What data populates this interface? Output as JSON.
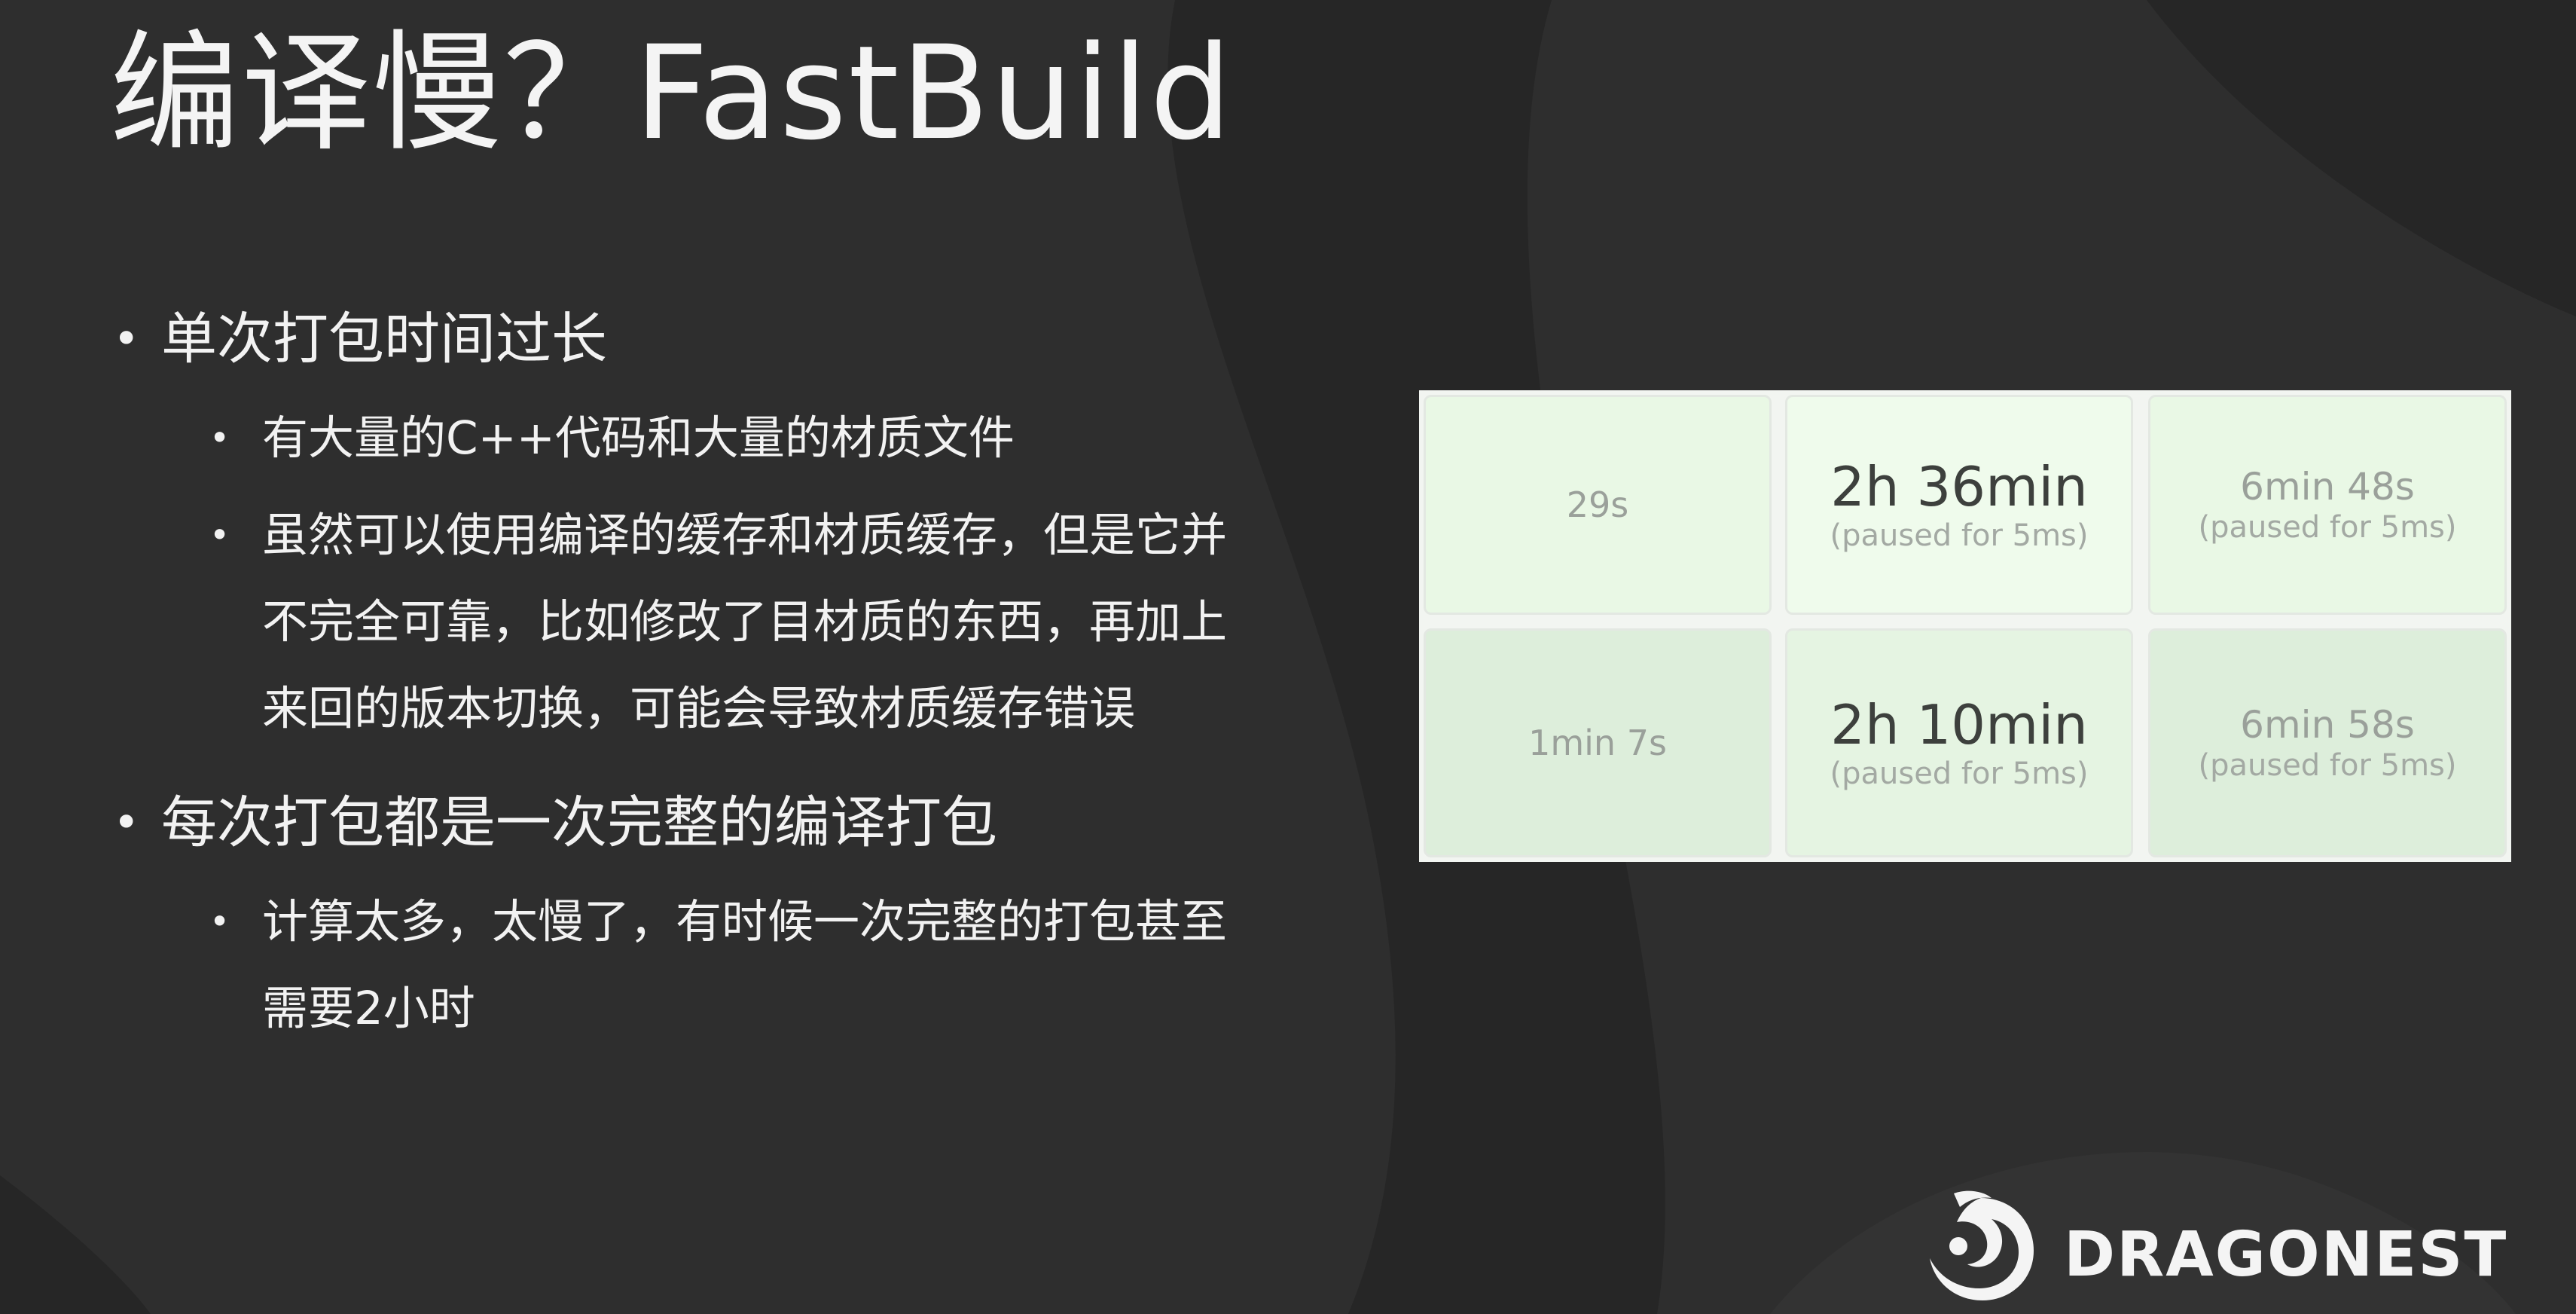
{
  "slide": {
    "title": "编译慢？FastBuild",
    "bullets": [
      {
        "text": "单次打包时间过长",
        "sub": [
          "有大量的C++代码和大量的材质文件",
          "虽然可以使用编译的缓存和材质缓存，但是它并不完全可靠，比如修改了目材质的东西，再加上来回的版本切换，可能会导致材质缓存错误"
        ]
      },
      {
        "text": "每次打包都是一次完整的编译打包",
        "sub": [
          "计算太多，太慢了，有时候一次完整的打包甚至需要2小时"
        ]
      }
    ]
  },
  "build_times": {
    "tiles": [
      {
        "time": "29s",
        "note": ""
      },
      {
        "time": "2h 36min",
        "note": "(paused for 5ms)"
      },
      {
        "time": "6min 48s",
        "note": "(paused for 5ms)"
      },
      {
        "time": "1min 7s",
        "note": ""
      },
      {
        "time": "2h 10min",
        "note": "(paused for 5ms)"
      },
      {
        "time": "6min 58s",
        "note": "(paused for 5ms)"
      }
    ],
    "colors": {
      "row1": [
        "#e9f8e5",
        "#effbec",
        "#e9f8e5"
      ],
      "row2": [
        "#ddeedb",
        "#e5f4e2",
        "#ddeedb"
      ]
    }
  },
  "logo": {
    "text": "DRAGONEST",
    "icon": "dragon-logo-icon"
  },
  "theme": {
    "background": "#2e2e2e",
    "shape": "#262626",
    "text": "#f2f2f2"
  }
}
